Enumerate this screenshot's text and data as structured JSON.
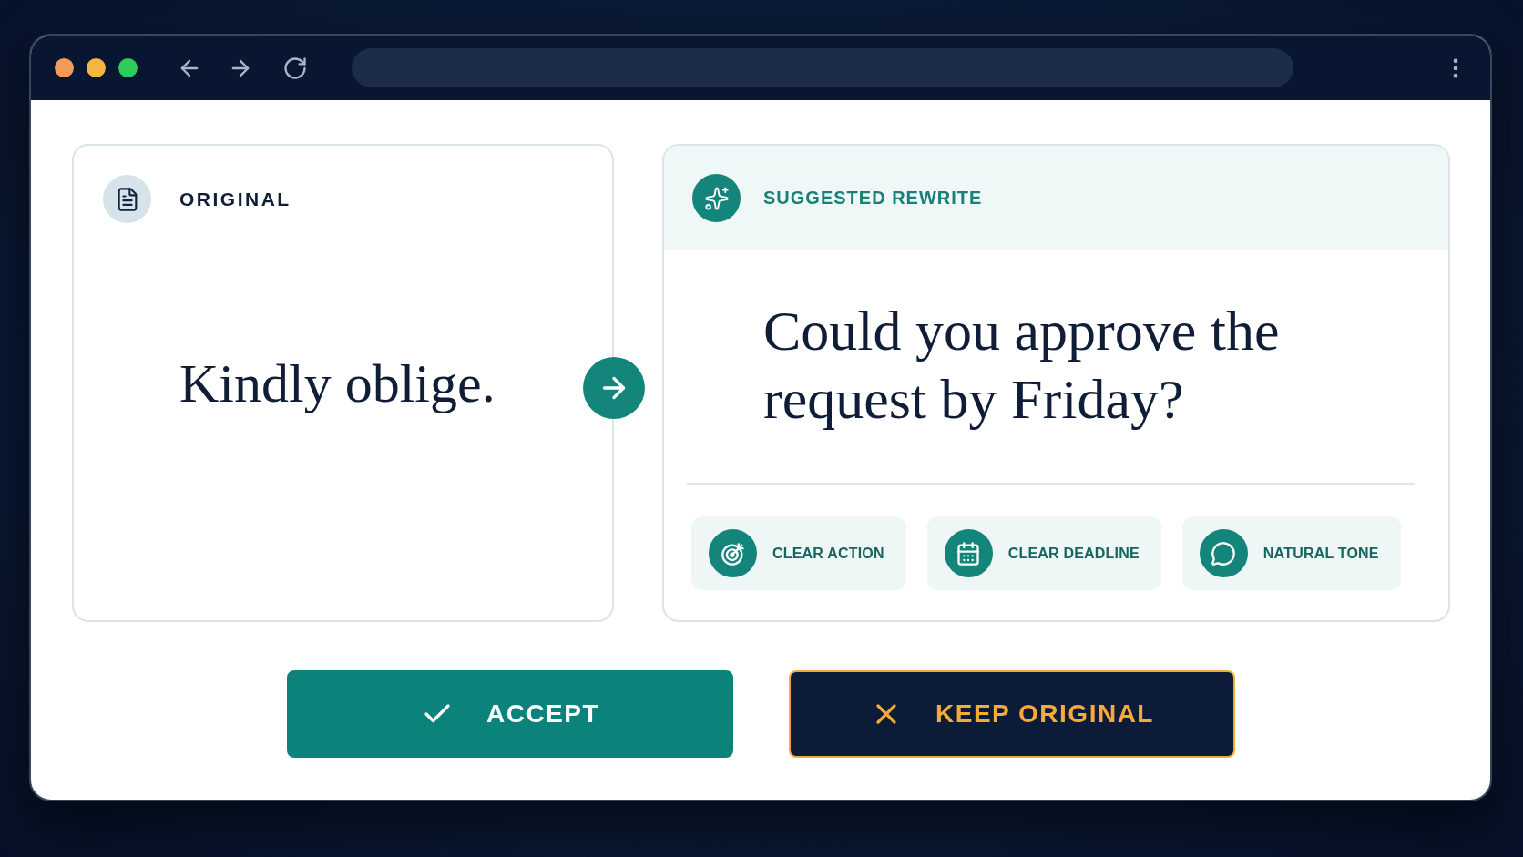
{
  "original": {
    "label": "ORIGINAL",
    "text": "Kindly oblige."
  },
  "rewrite": {
    "label": "SUGGESTED REWRITE",
    "text": "Could you approve the request by Friday?",
    "qualities": [
      {
        "kind": "action",
        "label": "CLEAR ACTION"
      },
      {
        "kind": "deadline",
        "label": "CLEAR DEADLINE"
      },
      {
        "kind": "tone",
        "label": "NATURAL TONE"
      }
    ]
  },
  "actions": [
    {
      "kind": "accept",
      "label": "ACCEPT"
    },
    {
      "kind": "keep",
      "label": "KEEP ORIGINAL"
    }
  ]
}
